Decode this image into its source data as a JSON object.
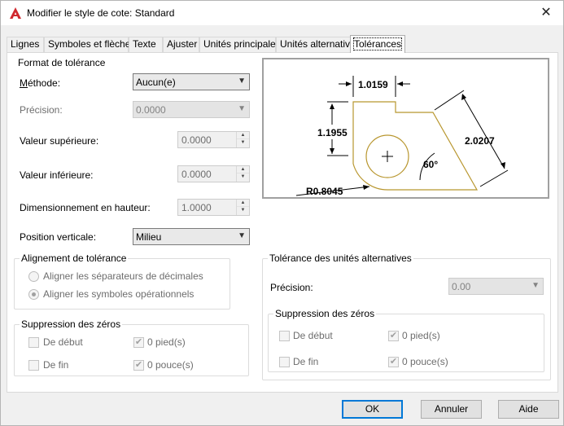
{
  "window": {
    "title": "Modifier le style de cote: Standard",
    "close_glyph": "✕"
  },
  "tabs": [
    {
      "label": "Lignes"
    },
    {
      "label": "Symboles et flèches"
    },
    {
      "label": "Texte"
    },
    {
      "label": "Ajuster"
    },
    {
      "label": "Unités principales"
    },
    {
      "label": "Unités alternatives"
    },
    {
      "label": "Tolérances",
      "active": true
    }
  ],
  "format": {
    "title": "Format de tolérance",
    "methode_label": "Méthode:",
    "methode_value": "Aucun(e)",
    "precision_label": "Précision:",
    "precision_value": "0.0000",
    "sup_label": "Valeur supérieure:",
    "sup_value": "0.0000",
    "inf_label": "Valeur inférieure:",
    "inf_value": "0.0000",
    "hauteur_label": "Dimensionnement en hauteur:",
    "hauteur_value": "1.0000",
    "position_label": "Position verticale:",
    "position_value": "Milieu"
  },
  "alignement": {
    "title": "Alignement de tolérance",
    "opt1": "Aligner les séparateurs de décimales",
    "opt2": "Aligner les symboles opérationnels",
    "selected": 2
  },
  "zeros_left": {
    "title": "Suppression des zéros",
    "debut": "De début",
    "fin": "De fin",
    "pied": "0 pied(s)",
    "pouce": "0 pouce(s)",
    "pied_checked": true,
    "pouce_checked": true
  },
  "alt": {
    "title": "Tolérance des unités alternatives",
    "precision_label": "Précision:",
    "precision_value": "0.00"
  },
  "zeros_right": {
    "title": "Suppression des zéros",
    "debut": "De début",
    "fin": "De fin",
    "pied": "0 pied(s)",
    "pouce": "0 pouce(s)",
    "pied_checked": true,
    "pouce_checked": true
  },
  "preview": {
    "dim_top": "1.0159",
    "dim_left": "1.1955",
    "dim_right": "2.0207",
    "angle": "60°",
    "radius": "R0.8045"
  },
  "buttons": {
    "ok": "OK",
    "cancel": "Annuler",
    "help": "Aide"
  },
  "colors": {
    "accent": "#0078d7",
    "app_icon": "#d0282e",
    "drawing_outline": "#b8962e"
  }
}
